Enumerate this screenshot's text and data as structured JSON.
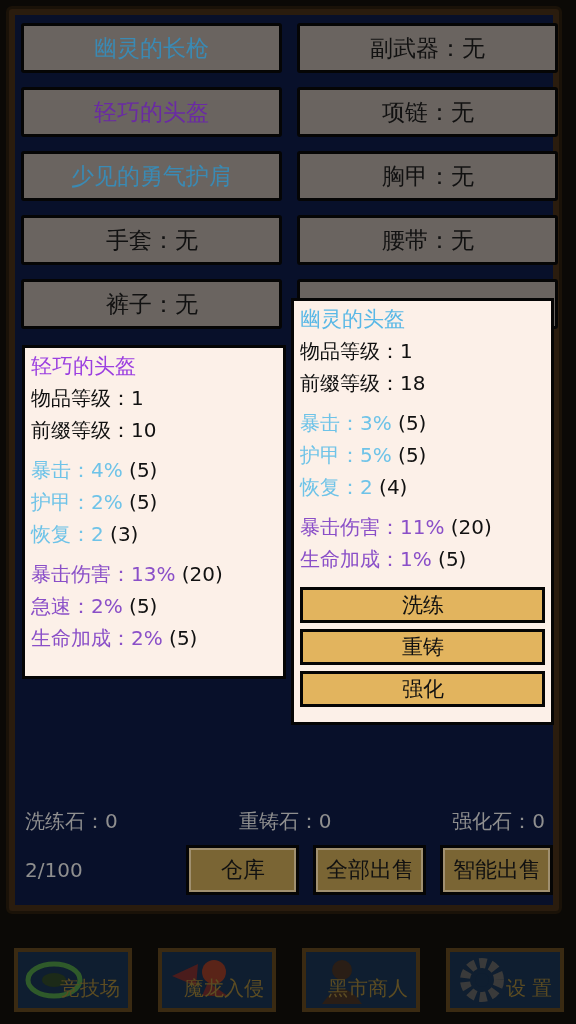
{
  "slots": [
    {
      "kind": "item",
      "label": "幽灵的长枪",
      "color": "#3a8ab4"
    },
    {
      "kind": "item",
      "label": "副武器：无",
      "color": "#111111"
    },
    {
      "kind": "item",
      "label": "轻巧的头盔",
      "color": "#6a2aa4"
    },
    {
      "kind": "item",
      "label": "项链：无",
      "color": "#111111"
    },
    {
      "kind": "item",
      "label": "少见的勇气护肩",
      "color": "#3a8ab4"
    },
    {
      "kind": "item",
      "label": "胸甲：无",
      "color": "#111111"
    },
    {
      "kind": "item",
      "label": "手套：无",
      "color": "#111111"
    },
    {
      "kind": "item",
      "label": "腰带：无",
      "color": "#111111"
    },
    {
      "kind": "item",
      "label": "裤子：无",
      "color": "#111111"
    },
    {
      "kind": "covered"
    }
  ],
  "tooltips": [
    {
      "title": "轻巧的头盔",
      "color": "#9b3fe0",
      "item_level": "物品等级：1",
      "prefix_level": "前缀等级：10",
      "stat_groups": [
        [
          {
            "name": "暴击：",
            "value": "4%",
            "tier": "(5)",
            "color": "#6ec3e8"
          },
          {
            "name": "护甲：",
            "value": "2%",
            "tier": "(5)",
            "color": "#6ec3e8"
          },
          {
            "name": "恢复：",
            "value": "2",
            "tier": "(3)",
            "color": "#6ec3e8"
          }
        ],
        [
          {
            "name": "暴击伤害：",
            "value": "13%",
            "tier": "(20)",
            "color": "#8a4fc8"
          },
          {
            "name": "急速：",
            "value": "2%",
            "tier": "(5)",
            "color": "#8a4fc8"
          },
          {
            "name": "生命加成：",
            "value": "2%",
            "tier": "(5)",
            "color": "#8a4fc8"
          }
        ]
      ]
    },
    {
      "title": "幽灵的头盔",
      "color": "#5ab8e6",
      "item_level": "物品等级：1",
      "prefix_level": "前缀等级：18",
      "stat_groups": [
        [
          {
            "name": "暴击：",
            "value": "3%",
            "tier": "(5)",
            "color": "#6ec3e8"
          },
          {
            "name": "护甲：",
            "value": "5%",
            "tier": "(5)",
            "color": "#6ec3e8"
          },
          {
            "name": "恢复：",
            "value": "2",
            "tier": "(4)",
            "color": "#6ec3e8"
          }
        ],
        [
          {
            "name": "暴击伤害：",
            "value": "11%",
            "tier": "(20)",
            "color": "#8a4fc8"
          },
          {
            "name": "生命加成：",
            "value": "1%",
            "tier": "(5)",
            "color": "#8a4fc8"
          }
        ]
      ],
      "actions": [
        "洗练",
        "重铸",
        "强化"
      ]
    }
  ],
  "stones": [
    "洗练石：0",
    "重铸石：0",
    "强化石：0"
  ],
  "bag_count": "2/100",
  "bag_buttons": [
    "仓库",
    "全部出售",
    "智能出售"
  ],
  "nav": [
    {
      "kind": "arena",
      "label": "竞技场"
    },
    {
      "kind": "dragon",
      "label": "魔龙入侵"
    },
    {
      "kind": "merchant",
      "label": "黑市商人"
    },
    {
      "kind": "settings",
      "label": "设 置"
    }
  ]
}
